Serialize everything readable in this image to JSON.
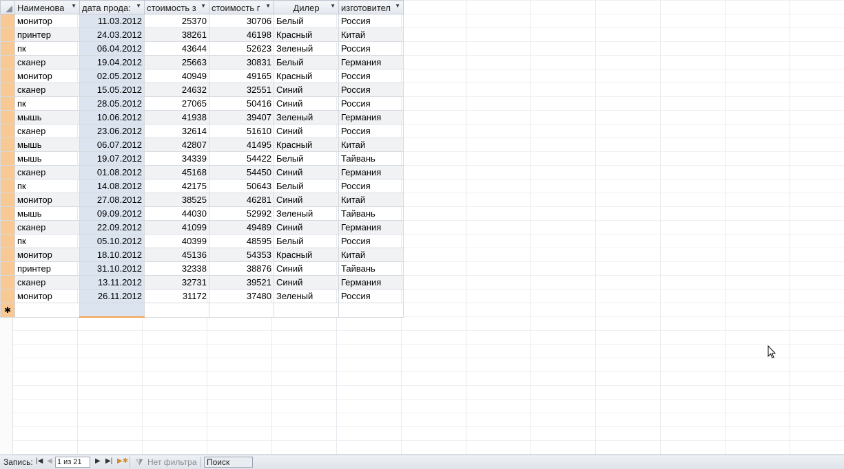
{
  "columns": [
    {
      "label": "Наименова"
    },
    {
      "label": "дата прода:"
    },
    {
      "label": "стоимость з"
    },
    {
      "label": "стоимость г"
    },
    {
      "label": "Дилер"
    },
    {
      "label": "изготовител"
    }
  ],
  "rows": [
    {
      "name": "монитор",
      "date": "11.03.2012",
      "cost1": "25370",
      "cost2": "30706",
      "dealer": "Белый",
      "maker": "Россия"
    },
    {
      "name": "принтер",
      "date": "24.03.2012",
      "cost1": "38261",
      "cost2": "46198",
      "dealer": "Красный",
      "maker": "Китай"
    },
    {
      "name": "пк",
      "date": "06.04.2012",
      "cost1": "43644",
      "cost2": "52623",
      "dealer": "Зеленый",
      "maker": "Россия"
    },
    {
      "name": "сканер",
      "date": "19.04.2012",
      "cost1": "25663",
      "cost2": "30831",
      "dealer": "Белый",
      "maker": "Германия"
    },
    {
      "name": "монитор",
      "date": "02.05.2012",
      "cost1": "40949",
      "cost2": "49165",
      "dealer": "Красный",
      "maker": "Россия"
    },
    {
      "name": "сканер",
      "date": "15.05.2012",
      "cost1": "24632",
      "cost2": "32551",
      "dealer": "Синий",
      "maker": "Россия"
    },
    {
      "name": "пк",
      "date": "28.05.2012",
      "cost1": "27065",
      "cost2": "50416",
      "dealer": "Синий",
      "maker": "Россия"
    },
    {
      "name": "мышь",
      "date": "10.06.2012",
      "cost1": "41938",
      "cost2": "39407",
      "dealer": "Зеленый",
      "maker": "Германия"
    },
    {
      "name": "сканер",
      "date": "23.06.2012",
      "cost1": "32614",
      "cost2": "51610",
      "dealer": "Синий",
      "maker": "Россия"
    },
    {
      "name": "мышь",
      "date": "06.07.2012",
      "cost1": "42807",
      "cost2": "41495",
      "dealer": "Красный",
      "maker": "Китай"
    },
    {
      "name": "мышь",
      "date": "19.07.2012",
      "cost1": "34339",
      "cost2": "54422",
      "dealer": "Белый",
      "maker": "Тайвань"
    },
    {
      "name": "сканер",
      "date": "01.08.2012",
      "cost1": "45168",
      "cost2": "54450",
      "dealer": "Синий",
      "maker": "Германия"
    },
    {
      "name": "пк",
      "date": "14.08.2012",
      "cost1": "42175",
      "cost2": "50643",
      "dealer": "Белый",
      "maker": "Россия"
    },
    {
      "name": "монитор",
      "date": "27.08.2012",
      "cost1": "38525",
      "cost2": "46281",
      "dealer": "Синий",
      "maker": "Китай"
    },
    {
      "name": "мышь",
      "date": "09.09.2012",
      "cost1": "44030",
      "cost2": "52992",
      "dealer": "Зеленый",
      "maker": "Тайвань"
    },
    {
      "name": "сканер",
      "date": "22.09.2012",
      "cost1": "41099",
      "cost2": "49489",
      "dealer": "Синий",
      "maker": "Германия"
    },
    {
      "name": "пк",
      "date": "05.10.2012",
      "cost1": "40399",
      "cost2": "48595",
      "dealer": "Белый",
      "maker": "Россия"
    },
    {
      "name": "монитор",
      "date": "18.10.2012",
      "cost1": "45136",
      "cost2": "54353",
      "dealer": "Красный",
      "maker": "Китай"
    },
    {
      "name": "принтер",
      "date": "31.10.2012",
      "cost1": "32338",
      "cost2": "38876",
      "dealer": "Синий",
      "maker": "Тайвань"
    },
    {
      "name": "сканер",
      "date": "13.11.2012",
      "cost1": "32731",
      "cost2": "39521",
      "dealer": "Синий",
      "maker": "Германия"
    },
    {
      "name": "монитор",
      "date": "26.11.2012",
      "cost1": "31172",
      "cost2": "37480",
      "dealer": "Зеленый",
      "maker": "Россия"
    }
  ],
  "new_row_marker": "✱",
  "status": {
    "record_label": "Запись:",
    "record_value": "1 из 21",
    "filter_label": "Нет фильтра",
    "search_label": "Поиск"
  },
  "colors": {
    "selection_border": "#f4a14a",
    "row_selector": "#f8c995",
    "selected_column_fill": "#dce4ef"
  }
}
